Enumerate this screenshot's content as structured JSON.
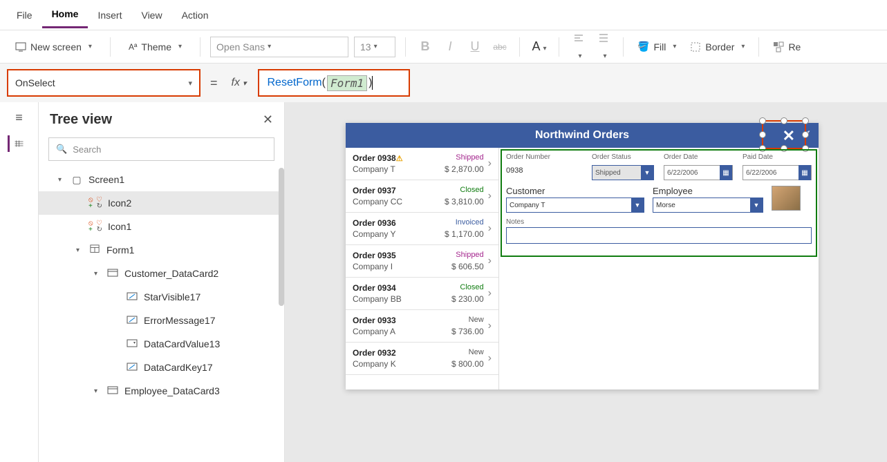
{
  "menu": {
    "file": "File",
    "home": "Home",
    "insert": "Insert",
    "view": "View",
    "action": "Action"
  },
  "toolbar": {
    "newscreen": "New screen",
    "theme": "Theme",
    "font": "Open Sans",
    "size": "13",
    "fill": "Fill",
    "border": "Border",
    "reorder": "Re"
  },
  "formula": {
    "property": "OnSelect",
    "fn": "ResetForm",
    "arg": "Form1"
  },
  "treeview": {
    "title": "Tree view",
    "search_placeholder": "Search",
    "nodes": {
      "screen1": "Screen1",
      "icon2": "Icon2",
      "icon1": "Icon1",
      "form1": "Form1",
      "customer_dc": "Customer_DataCard2",
      "starvis": "StarVisible17",
      "errmsg": "ErrorMessage17",
      "dcval": "DataCardValue13",
      "dckey": "DataCardKey17",
      "employee_dc": "Employee_DataCard3"
    }
  },
  "app": {
    "title": "Northwind Orders",
    "orders": [
      {
        "id": "Order 0938",
        "warn": true,
        "status": "Shipped",
        "sclass": "s-shipped",
        "company": "Company T",
        "amount": "$ 2,870.00"
      },
      {
        "id": "Order 0937",
        "status": "Closed",
        "sclass": "s-closed",
        "company": "Company CC",
        "amount": "$ 3,810.00"
      },
      {
        "id": "Order 0936",
        "status": "Invoiced",
        "sclass": "s-invoiced",
        "company": "Company Y",
        "amount": "$ 1,170.00"
      },
      {
        "id": "Order 0935",
        "status": "Shipped",
        "sclass": "s-shipped",
        "company": "Company I",
        "amount": "$ 606.50"
      },
      {
        "id": "Order 0934",
        "status": "Closed",
        "sclass": "s-closed",
        "company": "Company BB",
        "amount": "$ 230.00"
      },
      {
        "id": "Order 0933",
        "status": "New",
        "sclass": "s-new",
        "company": "Company A",
        "amount": "$ 736.00"
      },
      {
        "id": "Order 0932",
        "status": "New",
        "sclass": "s-new",
        "company": "Company K",
        "amount": "$ 800.00"
      }
    ],
    "form": {
      "ordernum_lbl": "Order Number",
      "ordernum": "0938",
      "status_lbl": "Order Status",
      "status": "Shipped",
      "orderdate_lbl": "Order Date",
      "orderdate": "6/22/2006",
      "paiddate_lbl": "Paid Date",
      "paiddate": "6/22/2006",
      "customer_lbl": "Customer",
      "customer": "Company T",
      "employee_lbl": "Employee",
      "employee": "Morse",
      "notes_lbl": "Notes"
    }
  }
}
